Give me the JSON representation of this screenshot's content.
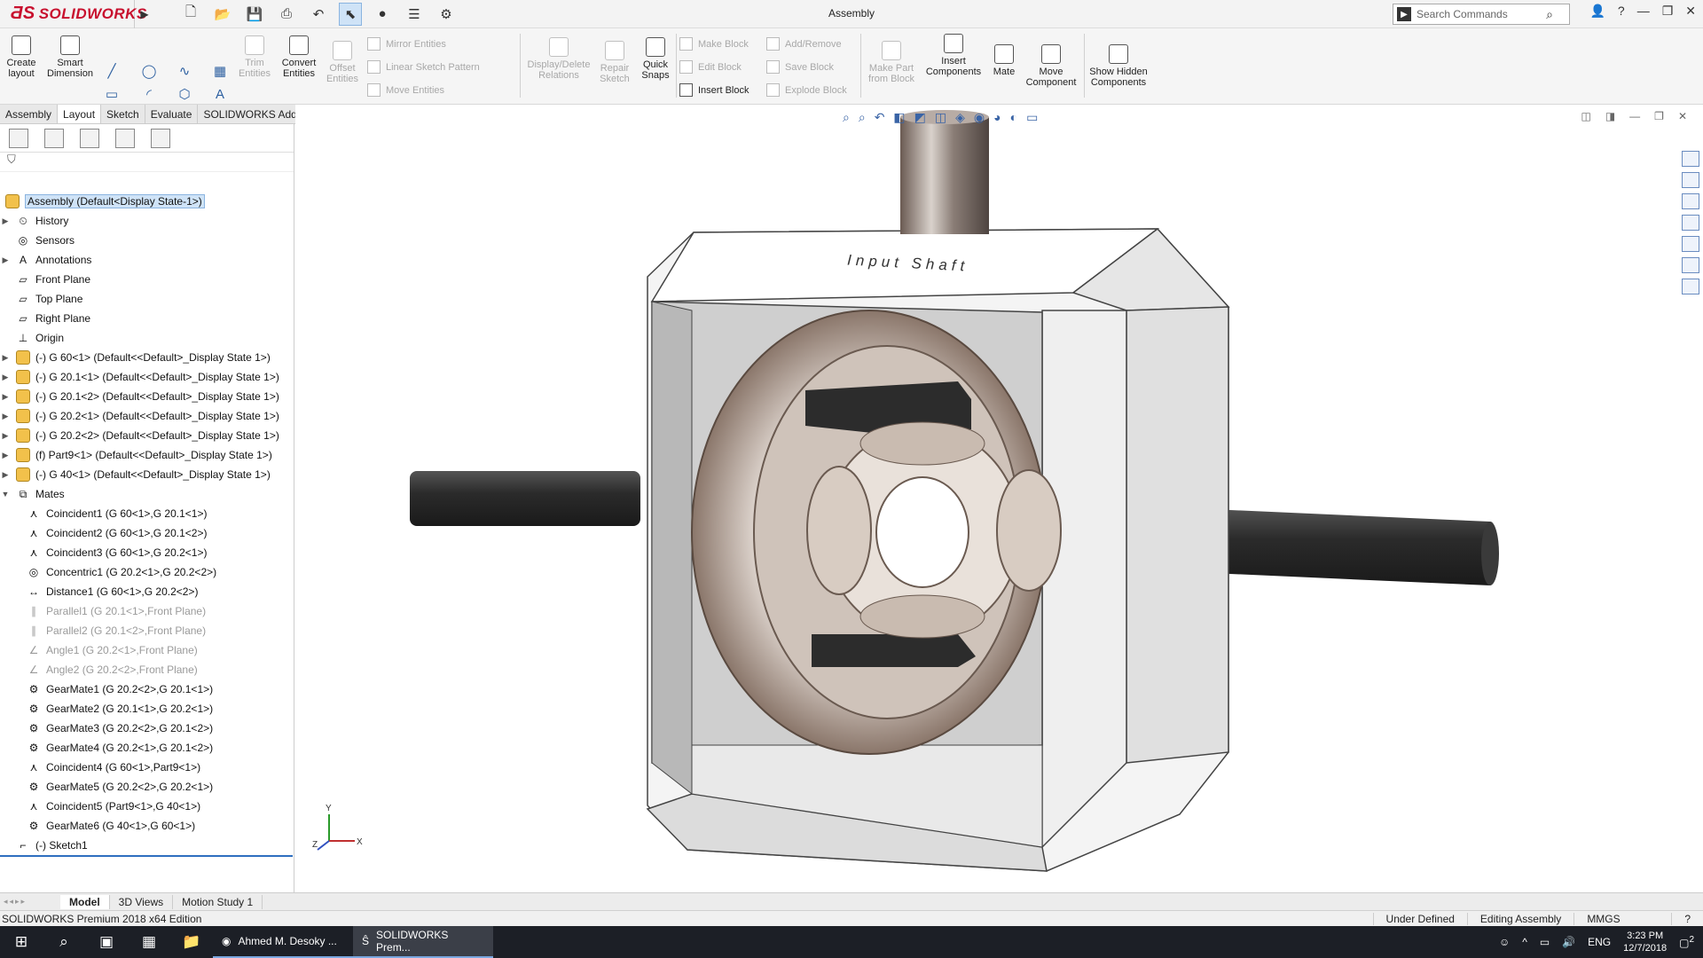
{
  "app": {
    "brand": "SOLIDWORKS",
    "title": "Assembly"
  },
  "search": {
    "placeholder": "Search Commands"
  },
  "cmd": {
    "create_layout": "Create layout",
    "smart_dimension": "Smart Dimension",
    "trim": "Trim Entities",
    "convert": "Convert Entities",
    "offset": "Offset Entities",
    "mirror": "Mirror Entities",
    "linear_pattern": "Linear Sketch Pattern",
    "move_entities": "Move Entities",
    "display_delete": "Display/Delete Relations",
    "repair": "Repair Sketch",
    "quick_snaps": "Quick Snaps",
    "make_block": "Make Block",
    "edit_block": "Edit Block",
    "insert_block": "Insert Block",
    "add_remove": "Add/Remove",
    "save_block": "Save Block",
    "explode_block": "Explode Block",
    "make_part": "Make Part from Block",
    "insert_components": "Insert Components",
    "mate": "Mate",
    "move_component": "Move Component",
    "show_hidden": "Show Hidden Components"
  },
  "tabs": [
    "Assembly",
    "Layout",
    "Sketch",
    "Evaluate",
    "SOLIDWORKS Add-Ins"
  ],
  "tree": {
    "root": "Assembly  (Default<Display State-1>)",
    "items": [
      "History",
      "Sensors",
      "Annotations",
      "Front Plane",
      "Top Plane",
      "Right Plane",
      "Origin"
    ],
    "parts": [
      "(-) G 60<1> (Default<<Default>_Display State 1>)",
      "(-) G 20.1<1> (Default<<Default>_Display State 1>)",
      "(-) G 20.1<2> (Default<<Default>_Display State 1>)",
      "(-) G 20.2<1> (Default<<Default>_Display State 1>)",
      "(-) G 20.2<2> (Default<<Default>_Display State 1>)",
      "(f) Part9<1> (Default<<Default>_Display State 1>)",
      "(-) G 40<1> (Default<<Default>_Display State 1>)"
    ],
    "mates_label": "Mates",
    "mates": [
      "Coincident1 (G 60<1>,G 20.1<1>)",
      "Coincident2 (G 60<1>,G 20.1<2>)",
      "Coincident3 (G 60<1>,G 20.2<1>)",
      "Concentric1 (G 20.2<1>,G 20.2<2>)",
      "Distance1 (G 60<1>,G 20.2<2>)",
      "Parallel1 (G 20.1<1>,Front Plane)",
      "Parallel2 (G 20.1<2>,Front Plane)",
      "Angle1 (G 20.2<1>,Front Plane)",
      "Angle2 (G 20.2<2>,Front Plane)",
      "GearMate1 (G 20.2<2>,G 20.1<1>)",
      "GearMate2 (G 20.1<1>,G 20.2<1>)",
      "GearMate3 (G 20.2<2>,G 20.1<2>)",
      "GearMate4 (G 20.2<1>,G 20.1<2>)",
      "Coincident4 (G 60<1>,Part9<1>)",
      "GearMate5 (G 20.2<2>,G 20.2<1>)",
      "Coincident5 (Part9<1>,G 40<1>)",
      "GearMate6 (G 40<1>,G 60<1>)"
    ],
    "sketch": "(-) Sketch1"
  },
  "model": {
    "label": "Input Shaft",
    "axis_x": "X",
    "axis_y": "Y",
    "axis_z": "Z"
  },
  "bottom_tabs": [
    "Model",
    "3D Views",
    "Motion Study 1"
  ],
  "status": {
    "edition": "SOLIDWORKS Premium 2018 x64 Edition",
    "state": "Under Defined",
    "mode": "Editing Assembly",
    "units": "MMGS"
  },
  "taskbar": {
    "chrome": "Ahmed M. Desoky ...",
    "sw": "SOLIDWORKS Prem...",
    "lang": "ENG",
    "time": "3:23 PM",
    "date": "12/7/2018",
    "notif": "2"
  }
}
